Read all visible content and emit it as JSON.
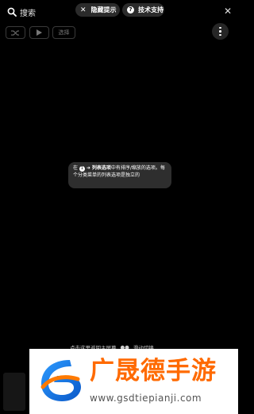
{
  "search": {
    "text": "搜索"
  },
  "pills": {
    "hide_label": "隐藏提示",
    "support_label": "技术支持"
  },
  "controls": {
    "select_label": "选择"
  },
  "tooltip": {
    "prefix": "在",
    "step": "1",
    "arrow": "➜",
    "bold": "列表选项",
    "rest": "中有排序/缩放的选项。每个分类菜单的列表选项是独立的"
  },
  "bottom_hint": {
    "left": "点击这里返回主屏幕",
    "right": "滑动切换"
  },
  "watermark": {
    "title": "广晟德手游",
    "url": "www.gsdtiepianji.com"
  },
  "colors": {
    "title_orange": "#ff6a00",
    "logo_blue": "#1a7fe0"
  }
}
